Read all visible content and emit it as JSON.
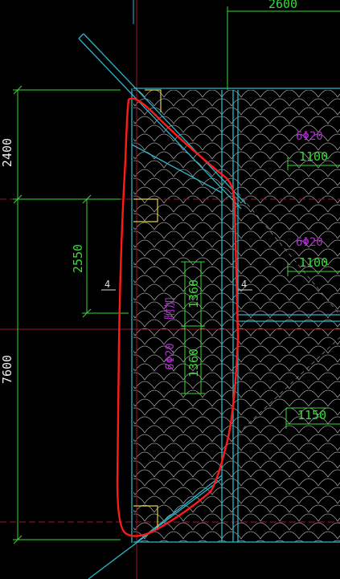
{
  "colors": {
    "background": "#000000",
    "cyan": "#2ab7c9",
    "dim_green": "#33dd33",
    "rebar_magenta": "#b030d0",
    "grid_red": "#a0152a",
    "tile_gray": "#b8b8b8",
    "markup_red": "#ff1a1a",
    "white": "#eeeeee",
    "yellow": "#e0d040"
  },
  "dimensions": {
    "top_span": "2600",
    "left_upper": "2400",
    "left_lower": "7600",
    "inner_span": "2550",
    "rebar_span_1": "1100",
    "rebar_span_2": "1100",
    "rebar_span_3": "1150",
    "diag_span_1": "1360",
    "diag_span_2": "1360"
  },
  "rebar_labels": {
    "top_right_1": "6Φ20",
    "top_right_2": "6Φ20",
    "diag_main": "6Φ20",
    "diag_note": "附加"
  },
  "section_tags": {
    "left": "4",
    "right": "4"
  },
  "icons": {
    "markup": "red-freehand-outline"
  }
}
